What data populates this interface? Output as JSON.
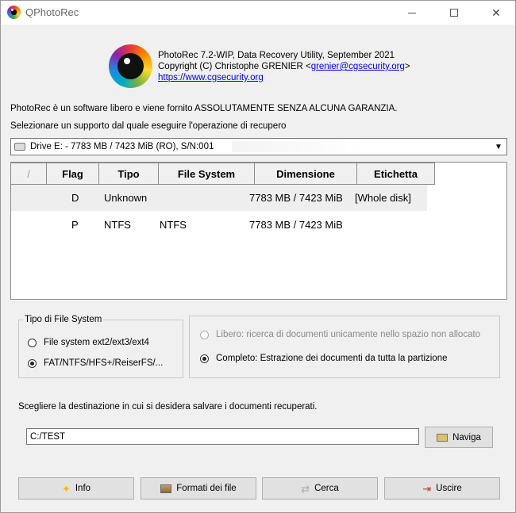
{
  "window": {
    "title": "QPhotoRec",
    "minimize_label": "—",
    "maximize_label": "☐",
    "close_label": "✕"
  },
  "header": {
    "line1": "PhotoRec 7.2-WIP, Data Recovery Utility, September 2021",
    "copyright_prefix": "Copyright (C) Christophe GRENIER <",
    "email": "grenier@cgsecurity.org",
    "copyright_suffix": ">",
    "website": "https://www.cgsecurity.org"
  },
  "intro": {
    "license_text": "PhotoRec è un software libero e viene fornito ASSOLUTAMENTE SENZA ALCUNA GARANZIA.",
    "select_prompt": "Selezionare un supporto dal quale eseguire l'operazione di recupero"
  },
  "drive_select": {
    "selected": "Drive E: - 7783 MB / 7423 MiB (RO), S/N:001"
  },
  "partition_table": {
    "columns": [
      "/",
      "Flag",
      "Tipo",
      "File System",
      "Dimensione",
      "Etichetta"
    ],
    "rows": [
      {
        "flag": "D",
        "type": "Unknown",
        "fs": "",
        "size": "7783 MB / 7423 MiB",
        "label": "[Whole disk]"
      },
      {
        "flag": "P",
        "type": "NTFS",
        "fs": "NTFS",
        "size": "7783 MB / 7423 MiB",
        "label": ""
      }
    ]
  },
  "fs_type": {
    "legend": "Tipo di File System",
    "options": [
      {
        "label": "File system ext2/ext3/ext4",
        "checked": false
      },
      {
        "label": "FAT/NTFS/HFS+/ReiserFS/...",
        "checked": true
      }
    ]
  },
  "mode": {
    "options": [
      {
        "label": "Libero: ricerca di documenti unicamente nello spazio non allocato",
        "checked": false,
        "enabled": false
      },
      {
        "label": "Completo: Estrazione dei documenti da tutta la partizione",
        "checked": true,
        "enabled": true
      }
    ]
  },
  "destination": {
    "label": "Scegliere la destinazione in cui si desidera salvare i documenti recuperati.",
    "value": "C:/TEST",
    "browse_label": "Naviga"
  },
  "buttons": {
    "info": "Info",
    "formats": "Formati dei file",
    "search": "Cerca",
    "exit": "Uscire"
  },
  "colors": {
    "link": "#0000ee",
    "window_bg": "#f0f0f0"
  }
}
